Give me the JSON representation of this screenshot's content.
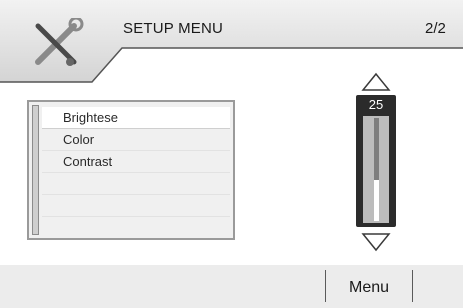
{
  "header": {
    "title": "SETUP MENU",
    "page_indicator": "2/2",
    "icon": "tools-icon"
  },
  "menu": {
    "items": [
      {
        "label": "Brightese",
        "selected": true
      },
      {
        "label": "Color",
        "selected": false
      },
      {
        "label": "Contrast",
        "selected": false
      },
      {
        "label": "",
        "selected": false
      },
      {
        "label": "",
        "selected": false
      }
    ]
  },
  "slider": {
    "value": "25",
    "level_fraction": 0.4
  },
  "footer": {
    "menu_label": "Menu"
  },
  "colors": {
    "header_band": "#d6d6d6",
    "footer_band": "#ececec",
    "slider_frame": "#2b2b2b"
  }
}
